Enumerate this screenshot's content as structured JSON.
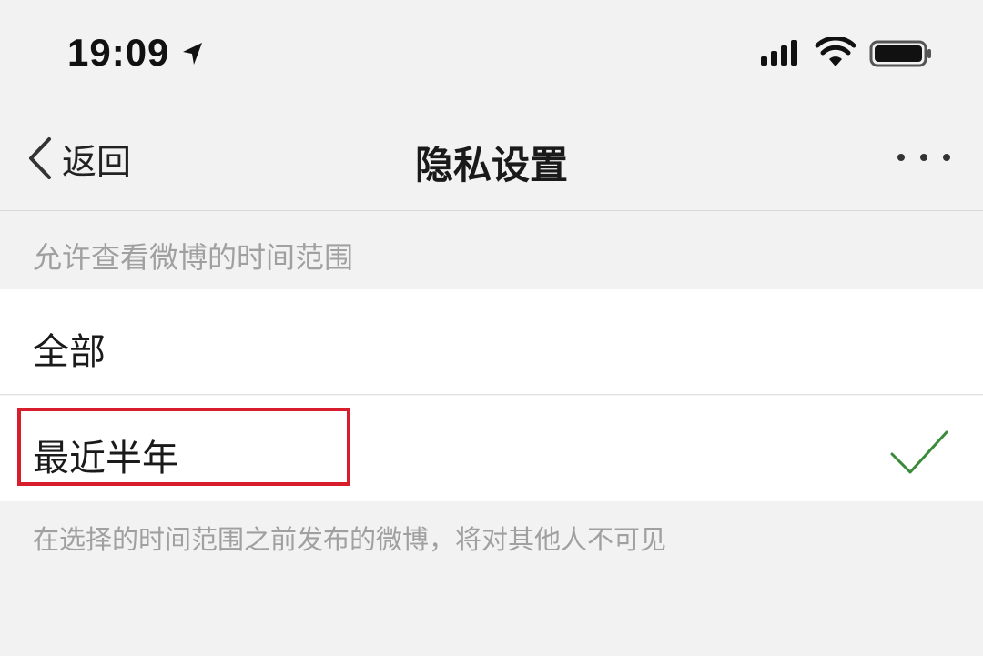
{
  "status_bar": {
    "time": "19:09",
    "icons": [
      "location-arrow-icon",
      "signal-icon",
      "wifi-icon",
      "battery-icon"
    ]
  },
  "nav": {
    "back_label": "返回",
    "title": "隐私设置",
    "more_icon": "more-dots-icon"
  },
  "section": {
    "header": "允许查看微博的时间范围",
    "options": [
      {
        "label": "全部",
        "selected": false
      },
      {
        "label": "最近半年",
        "selected": true,
        "highlighted": true
      }
    ],
    "footnote": "在选择的时间范围之前发布的微博，将对其他人不可见"
  },
  "colors": {
    "background": "#f2f2f2",
    "row_background": "#ffffff",
    "secondary_text": "#a0a0a0",
    "highlight_border": "#d81e2c",
    "checkmark": "#3a8a3a"
  }
}
